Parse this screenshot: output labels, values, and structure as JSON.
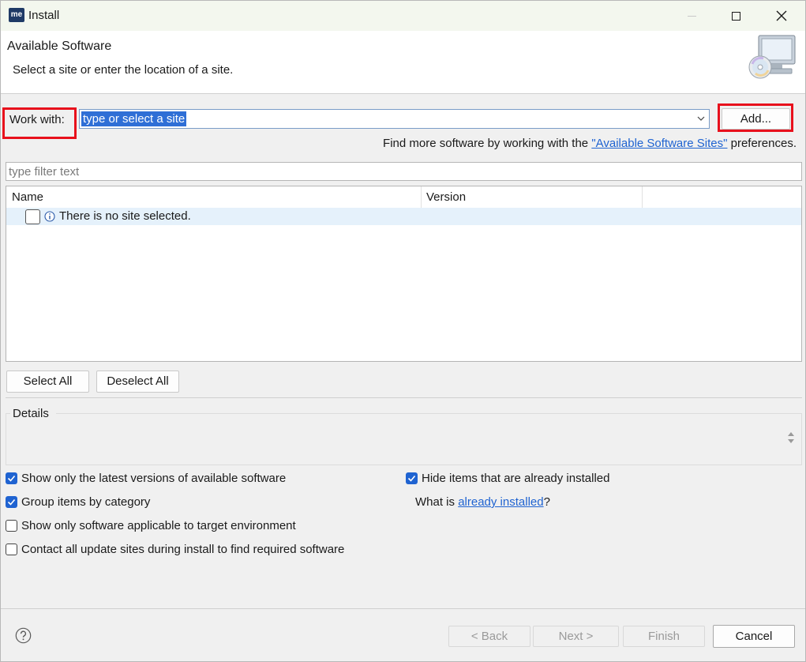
{
  "window": {
    "title": "Install",
    "app_icon_text": "me",
    "controls": {
      "minimize": "minimize-icon",
      "maximize": "maximize-icon",
      "close": "close-icon"
    }
  },
  "banner": {
    "title": "Available Software",
    "description": "Select a site or enter the location of a site.",
    "icon": "monitor-cd-icon"
  },
  "work_with": {
    "label": "Work with:",
    "value": "type or select a site",
    "add_label": "Add..."
  },
  "find_more": {
    "prefix": "Find more software by working with the ",
    "link": "\"Available Software Sites\"",
    "suffix": " preferences."
  },
  "filter": {
    "placeholder": "type filter text"
  },
  "table": {
    "columns": [
      "Name",
      "Version"
    ],
    "rows": [
      {
        "checked": false,
        "icon": "info-icon",
        "name": "There is no site selected.",
        "version": ""
      }
    ]
  },
  "selection_buttons": {
    "select_all": "Select All",
    "deselect_all": "Deselect All"
  },
  "details": {
    "label": "Details",
    "text": ""
  },
  "options": {
    "latest_versions": {
      "label": "Show only the latest versions of available software",
      "checked": true
    },
    "group_by_category": {
      "label": "Group items by category",
      "checked": true
    },
    "target_env": {
      "label": "Show only software applicable to target environment",
      "checked": false
    },
    "contact_all": {
      "label": "Contact all update sites during install to find required software",
      "checked": false
    },
    "hide_installed": {
      "label": "Hide items that are already installed",
      "checked": true
    },
    "what_is": {
      "prefix": "What is ",
      "link": "already installed",
      "suffix": "?"
    }
  },
  "footer": {
    "help_icon": "help-icon",
    "back": "< Back",
    "next": "Next >",
    "finish": "Finish",
    "cancel": "Cancel"
  },
  "colors": {
    "accent": "#1f63d1",
    "highlight": "#e8101c",
    "selection": "#2f6fd6",
    "row_selected": "#e5f1fb"
  }
}
